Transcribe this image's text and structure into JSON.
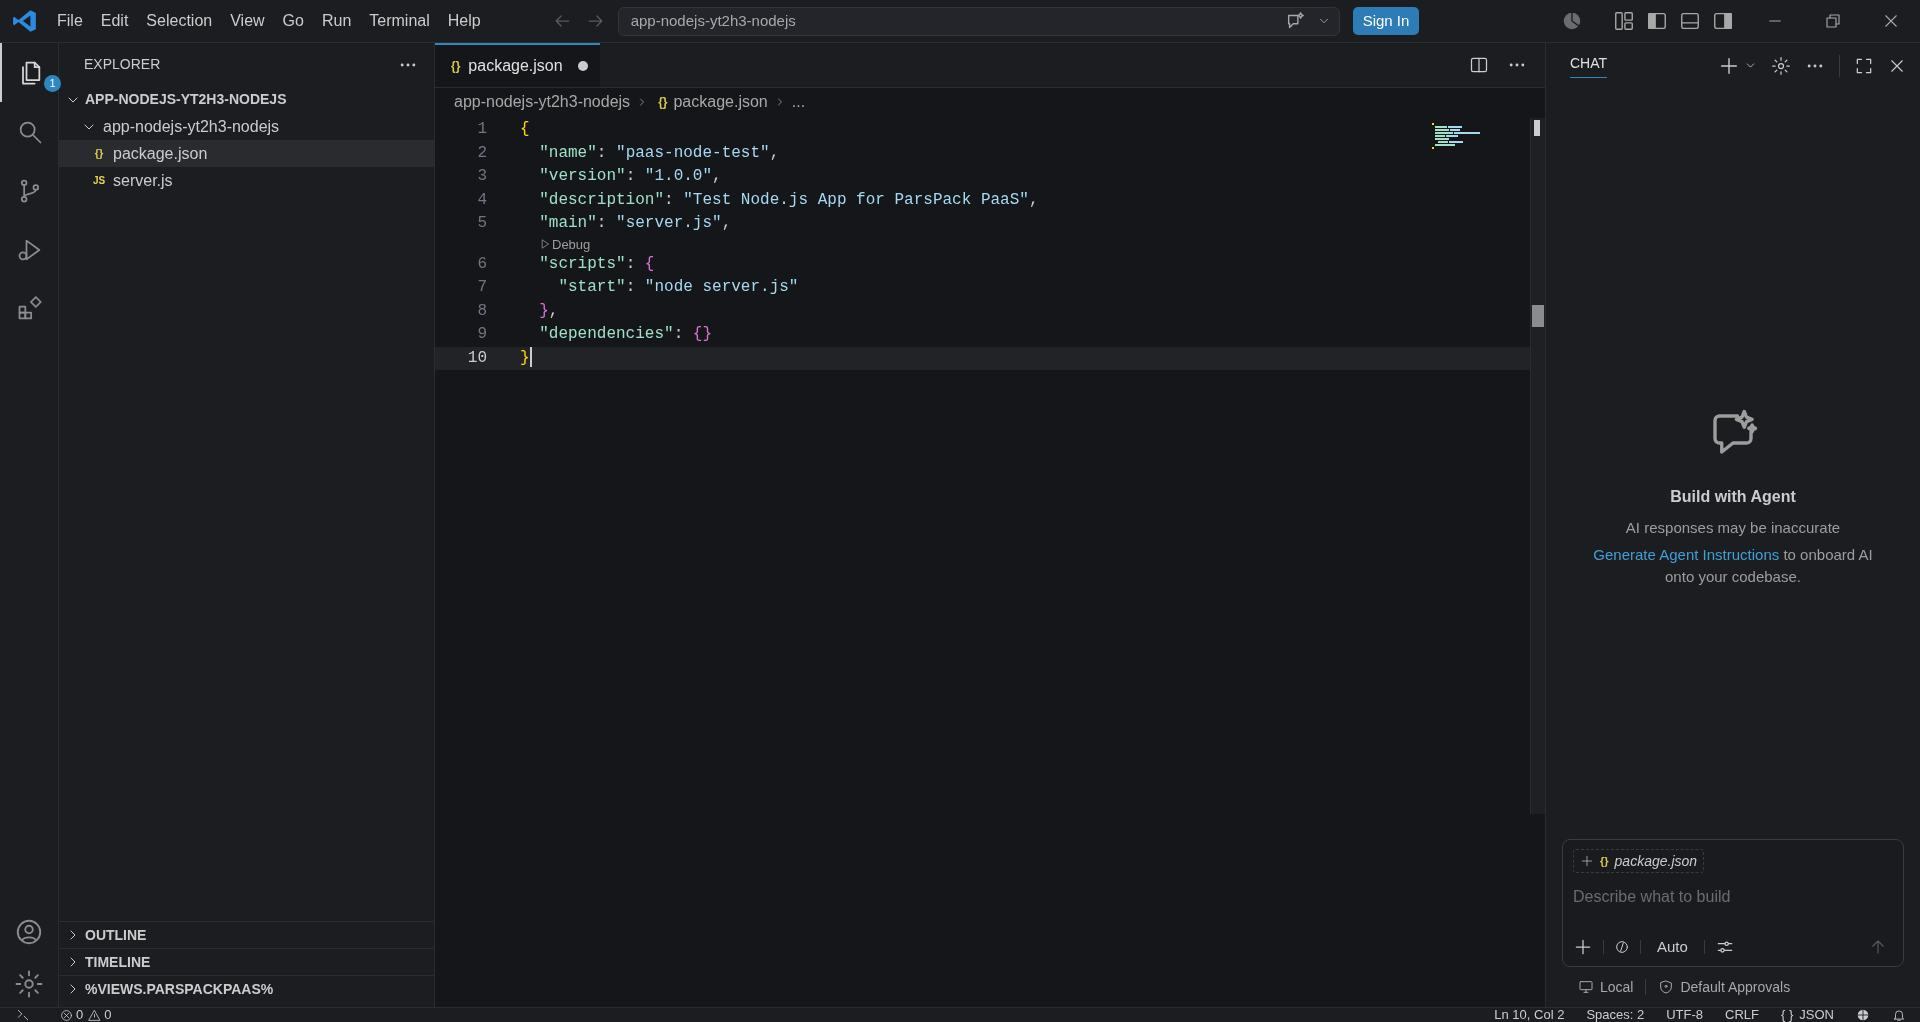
{
  "title_bar": {
    "menu": [
      "File",
      "Edit",
      "Selection",
      "View",
      "Go",
      "Run",
      "Terminal",
      "Help"
    ],
    "command_center": "app-nodejs-yt2h3-nodejs",
    "sign_in": "Sign In"
  },
  "activity_bar": {
    "items": [
      {
        "kind": "explorer",
        "selected": true,
        "badge": "1"
      },
      {
        "kind": "search",
        "selected": false
      },
      {
        "kind": "source-control",
        "selected": false
      },
      {
        "kind": "run-debug",
        "selected": false
      },
      {
        "kind": "extensions",
        "selected": false
      }
    ],
    "bottom": [
      {
        "kind": "accounts"
      },
      {
        "kind": "settings"
      }
    ]
  },
  "explorer": {
    "title": "EXPLORER",
    "root": {
      "label": "APP-NODEJS-YT2H3-NODEJS",
      "expanded": true,
      "children": [
        {
          "kind": "folder",
          "label": "app-nodejs-yt2h3-nodejs",
          "expanded": true,
          "selected": false,
          "children": [
            {
              "kind": "json",
              "icon": "{}",
              "label": "package.json",
              "selected": true
            },
            {
              "kind": "js",
              "icon": "JS",
              "label": "server.js",
              "selected": false
            }
          ]
        }
      ]
    },
    "sections": [
      {
        "label": "OUTLINE",
        "expanded": false
      },
      {
        "label": "TIMELINE",
        "expanded": false
      },
      {
        "label": "%VIEWS.PARSPACKPAAS%",
        "expanded": false
      }
    ]
  },
  "editor": {
    "tabs": [
      {
        "kind": "json",
        "icon": "{}",
        "label": "package.json",
        "selected": true,
        "modified": true
      }
    ],
    "breadcrumbs": [
      {
        "kind": "folder",
        "label": "app-nodejs-yt2h3-nodejs"
      },
      {
        "kind": "json",
        "icon": "{}",
        "label": "package.json"
      },
      {
        "kind": "more",
        "label": "..."
      }
    ],
    "lines": [
      {
        "kind": "code",
        "number": "1",
        "text": "{",
        "current": false
      },
      {
        "kind": "code",
        "number": "2",
        "text": "  \"name\": \"paas-node-test\",",
        "current": false
      },
      {
        "kind": "code",
        "number": "3",
        "text": "  \"version\": \"1.0.0\",",
        "current": false
      },
      {
        "kind": "code",
        "number": "4",
        "text": "  \"description\": \"Test Node.js App for ParsPack PaaS\",",
        "current": false
      },
      {
        "kind": "code",
        "number": "5",
        "text": "  \"main\": \"server.js\",",
        "current": false
      },
      {
        "kind": "codelens",
        "text": "Debug"
      },
      {
        "kind": "code",
        "number": "6",
        "text": "  \"scripts\": {",
        "current": false
      },
      {
        "kind": "code",
        "number": "7",
        "text": "    \"start\": \"node server.js\"",
        "current": false
      },
      {
        "kind": "code",
        "number": "8",
        "text": "  },",
        "current": false
      },
      {
        "kind": "code",
        "number": "9",
        "text": "  \"dependencies\": {}",
        "current": false
      },
      {
        "kind": "code",
        "number": "10",
        "text": "}",
        "current": true
      }
    ]
  },
  "chat": {
    "tab": "CHAT",
    "title": "Build with Agent",
    "note": "AI responses may be inaccurate",
    "link": "Generate Agent Instructions",
    "text": " to onboard AI onto your codebase.",
    "input": {
      "context_icon": "{}",
      "context": "package.json",
      "placeholder": "Describe what to build",
      "mode": "Auto"
    },
    "footer": [
      {
        "kind": "local",
        "label": "Local"
      },
      {
        "kind": "approvals",
        "label": "Default Approvals"
      }
    ]
  },
  "status_bar": {
    "errors": "0",
    "warnings": "0",
    "items": [
      {
        "kind": "text",
        "text": "Ln 10, Col 2"
      },
      {
        "kind": "text",
        "text": "Spaces: 2"
      },
      {
        "kind": "text",
        "text": "UTF-8"
      },
      {
        "kind": "text",
        "text": "CRLF"
      },
      {
        "kind": "language",
        "icon": "{ }",
        "text": "JSON"
      }
    ]
  }
}
